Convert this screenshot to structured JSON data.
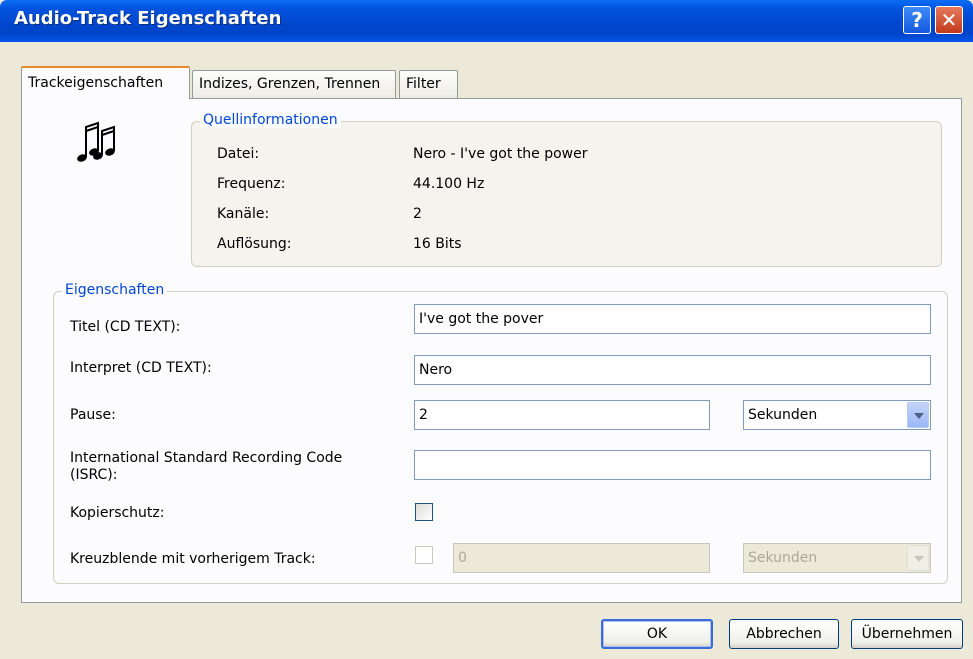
{
  "window": {
    "title": "Audio-Track Eigenschaften"
  },
  "tabs": [
    "Trackeigenschaften",
    "Indizes, Grenzen, Trennen",
    "Filter"
  ],
  "source": {
    "legend": "Quellinformationen",
    "rows": [
      {
        "label": "Datei:",
        "value": "Nero -  I've got the power"
      },
      {
        "label": "Frequenz:",
        "value": "44.100 Hz"
      },
      {
        "label": "Kanäle:",
        "value": "2"
      },
      {
        "label": "Auflösung:",
        "value": "16 Bits"
      }
    ]
  },
  "properties": {
    "legend": "Eigenschaften",
    "title_label": "Titel (CD TEXT):",
    "title_value": "I've got the pover",
    "artist_label": "Interpret (CD TEXT):",
    "artist_value": "Nero",
    "pause_label": "Pause:",
    "pause_value": "2",
    "pause_unit": "Sekunden",
    "isrc_label": "International Standard Recording Code (ISRC):",
    "isrc_value": "",
    "copy_label": "Kopierschutz:",
    "copy_checked": false,
    "crossfade_label": "Kreuzblende mit vorherigem Track:",
    "crossfade_value": "0",
    "crossfade_unit": "Sekunden"
  },
  "buttons": {
    "ok": "OK",
    "cancel": "Abbrechen",
    "apply": "Übernehmen"
  },
  "icons": {
    "help": "help-icon",
    "close": "close-icon",
    "track": "music-notes-icon"
  }
}
